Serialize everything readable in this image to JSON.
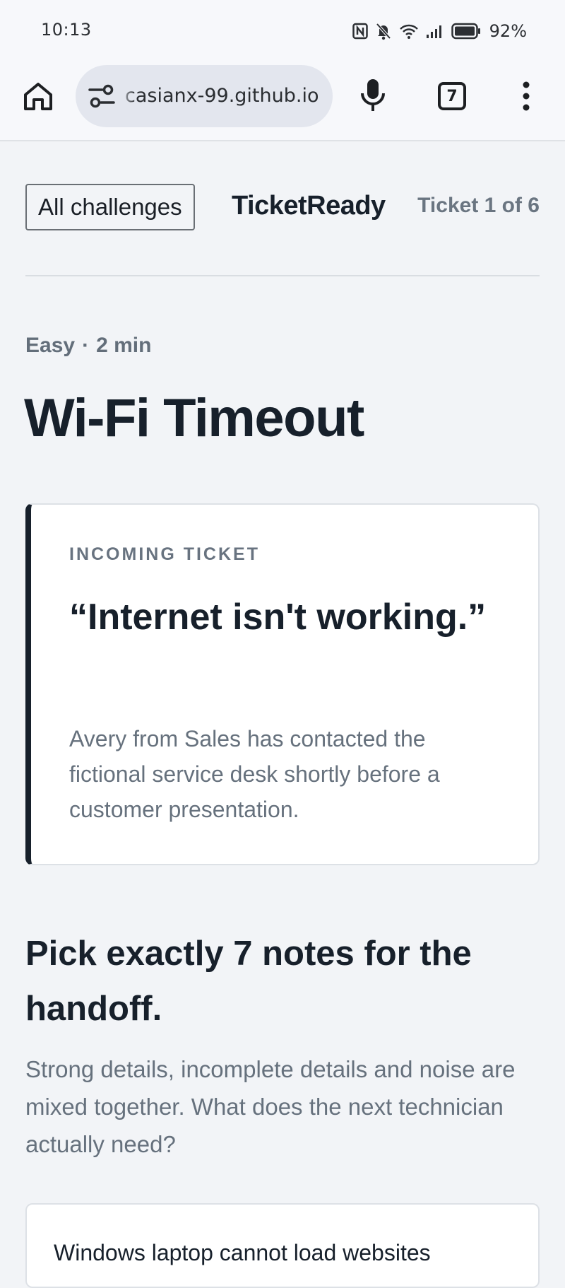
{
  "status_bar": {
    "time": "10:13",
    "battery_percent": "92%",
    "icons": [
      "nfc-icon",
      "bell-muted-icon",
      "wifi-icon",
      "cell-signal-icon",
      "battery-icon"
    ]
  },
  "browser": {
    "url": "casianx-99.github.io",
    "tab_count": "7",
    "icons": [
      "home-icon",
      "site-settings-icon",
      "microphone-icon",
      "tab-switcher-icon",
      "more-vert-icon"
    ]
  },
  "nav": {
    "all_challenges": "All challenges",
    "brand": "TicketReady",
    "ticket_count": "Ticket 1 of 6"
  },
  "challenge": {
    "difficulty": "Easy",
    "separator": "·",
    "duration": "2 min",
    "title": "Wi-Fi Timeout"
  },
  "ticket": {
    "label": "INCOMING TICKET",
    "quote": "“Internet isn't working.”",
    "description": "Avery from Sales has contacted the fictional service desk shortly before a customer presentation."
  },
  "prompt": {
    "heading": "Pick exactly 7 notes for the handoff.",
    "description": "Strong details, incomplete details and noise are mixed together. What does the next technician actually need?"
  },
  "notes": [
    {
      "text": "Windows laptop cannot load websites"
    }
  ],
  "colors": {
    "page_background": "#f2f4f7",
    "text_primary": "#17202b",
    "text_muted": "#66717d",
    "card_accent": "#17202b",
    "url_pill": "#e3e6ee"
  }
}
